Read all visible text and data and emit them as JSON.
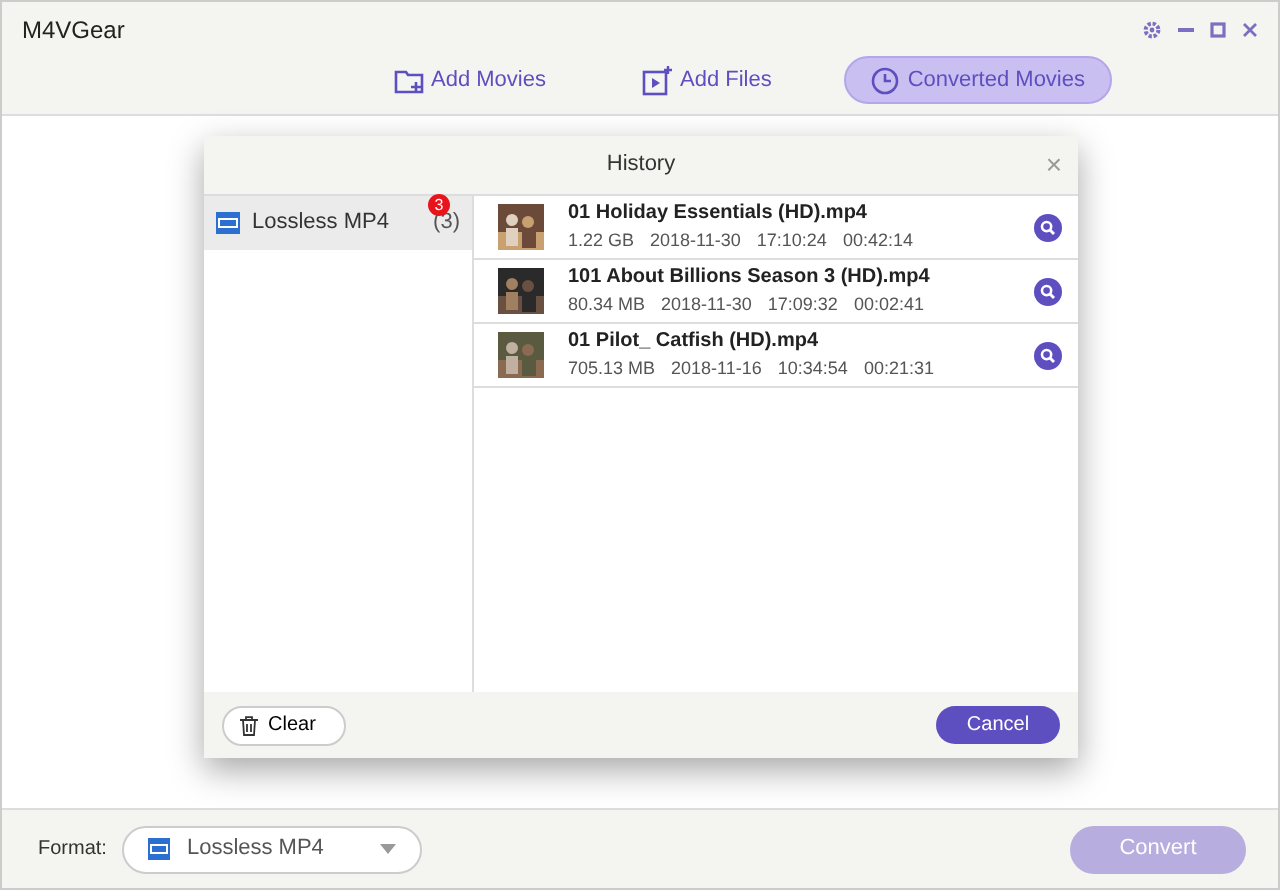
{
  "window": {
    "title": "M4VGear"
  },
  "tabs": [
    {
      "label": "Add Movies",
      "kind": "folder",
      "selected": false
    },
    {
      "label": "Add Files",
      "kind": "file",
      "selected": false
    },
    {
      "label": "Converted Movies",
      "kind": "clock",
      "selected": true
    }
  ],
  "dialog": {
    "title": "History",
    "close": "×",
    "categories": [
      {
        "label": "Lossless MP4",
        "badge": "3",
        "count": "(3)",
        "selected": true
      }
    ],
    "files": [
      {
        "name": "01 Holiday Essentials (HD).mp4",
        "size": "1.22 GB",
        "date": "2018-11-30",
        "time": "17:10:24",
        "duration": "00:42:14"
      },
      {
        "name": "101 About Billions Season 3 (HD).mp4",
        "size": "80.34 MB",
        "date": "2018-11-30",
        "time": "17:09:32",
        "duration": "00:02:41"
      },
      {
        "name": "01 Pilot_ Catfish (HD).mp4",
        "size": "705.13 MB",
        "date": "2018-11-16",
        "time": "10:34:54",
        "duration": "00:21:31"
      }
    ],
    "clear_button": "Clear",
    "cancel_button": "Cancel"
  },
  "footer": {
    "format_label": "Format:",
    "format_value": "Lossless MP4",
    "convert_button": "Convert",
    "convert_disabled": true
  }
}
